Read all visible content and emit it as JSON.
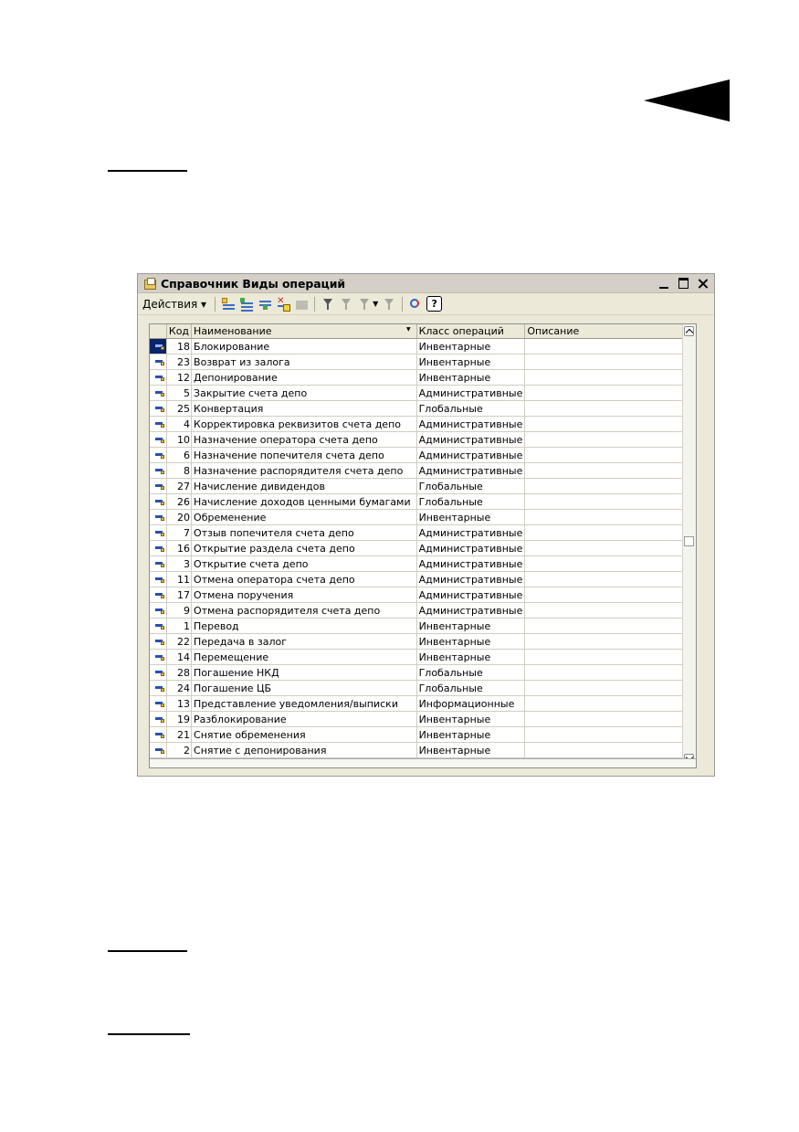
{
  "window": {
    "title": "Справочник Виды операций"
  },
  "toolbar": {
    "actions_label": "Действия",
    "help_label": "?"
  },
  "table": {
    "columns": [
      "Код",
      "Наименование",
      "Класс операций",
      "Описание"
    ],
    "rows": [
      {
        "code": "18",
        "name": "Блокирование",
        "cls": "Инвентарные",
        "desc": ""
      },
      {
        "code": "23",
        "name": "Возврат из залога",
        "cls": "Инвентарные",
        "desc": ""
      },
      {
        "code": "12",
        "name": "Депонирование",
        "cls": "Инвентарные",
        "desc": ""
      },
      {
        "code": "5",
        "name": "Закрытие счета депо",
        "cls": "Административные",
        "desc": ""
      },
      {
        "code": "25",
        "name": "Конвертация",
        "cls": "Глобальные",
        "desc": ""
      },
      {
        "code": "4",
        "name": "Корректировка реквизитов счета депо",
        "cls": "Административные",
        "desc": ""
      },
      {
        "code": "10",
        "name": "Назначение оператора счета депо",
        "cls": "Административные",
        "desc": ""
      },
      {
        "code": "6",
        "name": "Назначение попечителя счета депо",
        "cls": "Административные",
        "desc": ""
      },
      {
        "code": "8",
        "name": "Назначение распорядителя счета депо",
        "cls": "Административные",
        "desc": ""
      },
      {
        "code": "27",
        "name": "Начисление дивидендов",
        "cls": "Глобальные",
        "desc": ""
      },
      {
        "code": "26",
        "name": "Начисление доходов ценными бумагами",
        "cls": "Глобальные",
        "desc": ""
      },
      {
        "code": "20",
        "name": "Обременение",
        "cls": "Инвентарные",
        "desc": ""
      },
      {
        "code": "7",
        "name": "Отзыв попечителя счета депо",
        "cls": "Административные",
        "desc": ""
      },
      {
        "code": "16",
        "name": "Открытие раздела счета депо",
        "cls": "Административные",
        "desc": ""
      },
      {
        "code": "3",
        "name": "Открытие счета депо",
        "cls": "Административные",
        "desc": ""
      },
      {
        "code": "11",
        "name": "Отмена оператора счета депо",
        "cls": "Административные",
        "desc": ""
      },
      {
        "code": "17",
        "name": "Отмена поручения",
        "cls": "Административные",
        "desc": ""
      },
      {
        "code": "9",
        "name": "Отмена распорядителя счета депо",
        "cls": "Административные",
        "desc": ""
      },
      {
        "code": "1",
        "name": "Перевод",
        "cls": "Инвентарные",
        "desc": ""
      },
      {
        "code": "22",
        "name": "Передача в залог",
        "cls": "Инвентарные",
        "desc": ""
      },
      {
        "code": "14",
        "name": "Перемещение",
        "cls": "Инвентарные",
        "desc": ""
      },
      {
        "code": "28",
        "name": "Погашение НКД",
        "cls": "Глобальные",
        "desc": ""
      },
      {
        "code": "24",
        "name": "Погашение ЦБ",
        "cls": "Глобальные",
        "desc": ""
      },
      {
        "code": "13",
        "name": "Представление уведомления/выписки",
        "cls": "Информационные",
        "desc": ""
      },
      {
        "code": "19",
        "name": "Разблокирование",
        "cls": "Инвентарные",
        "desc": ""
      },
      {
        "code": "21",
        "name": "Снятие обременения",
        "cls": "Инвентарные",
        "desc": ""
      },
      {
        "code": "2",
        "name": "Снятие с депонирования",
        "cls": "Инвентарные",
        "desc": ""
      }
    ],
    "selected_row": 0
  }
}
